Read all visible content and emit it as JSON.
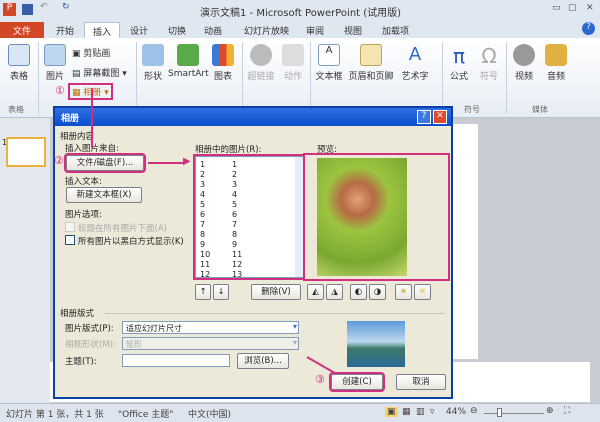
{
  "window": {
    "title": "演示文稿1 - Microsoft PowerPoint (试用版)"
  },
  "tabs": [
    "文件",
    "开始",
    "插入",
    "设计",
    "切换",
    "动画",
    "幻灯片放映",
    "审阅",
    "视图",
    "加载项"
  ],
  "ribbon": {
    "table": "表格",
    "picture": "图片",
    "clipart": "剪贴画",
    "screenshot": "屏幕截图",
    "album": "相册",
    "shapes": "形状",
    "smartart": "SmartArt",
    "chart": "图表",
    "hyperlink": "超链接",
    "action": "动作",
    "textbox": "文本框",
    "header_footer": "页眉和页脚",
    "wordart": "艺术字",
    "equation": "公式",
    "symbol": "符号",
    "video": "视频",
    "audio": "音频",
    "groups": {
      "tables": "表格",
      "symbols": "符号",
      "media": "媒体"
    }
  },
  "steps": [
    "①",
    "②",
    "③"
  ],
  "thumbnail_number": "1",
  "dialog": {
    "title": "相册",
    "album_content": "相册内容",
    "insert_from": "插入图片来自:",
    "file_disk_button": "文件/磁盘(F)...",
    "insert_text": "插入文本:",
    "new_textbox_button": "新建文本框(X)",
    "picture_options": "图片选项:",
    "caption_option": "标题在所有图片下面(A)",
    "bw_option": "所有图片以黑白方式显示(K)",
    "pictures_label": "相册中的图片(R):",
    "pictures": [
      [
        "1",
        "1"
      ],
      [
        "2",
        "2"
      ],
      [
        "3",
        "3"
      ],
      [
        "4",
        "4"
      ],
      [
        "5",
        "5"
      ],
      [
        "6",
        "6"
      ],
      [
        "7",
        "7"
      ],
      [
        "8",
        "8"
      ],
      [
        "9",
        "9"
      ],
      [
        "10",
        "11"
      ],
      [
        "11",
        "12"
      ],
      [
        "12",
        "13"
      ]
    ],
    "preview_label": "预览:",
    "remove_button": "删除(V)",
    "layout_section": "相册版式",
    "picture_layout_label": "图片版式(P):",
    "picture_layout_value": "适应幻灯片尺寸",
    "frame_shape_label": "相框形状(M):",
    "frame_shape_value": "矩形",
    "theme_label": "主题(T):",
    "theme_value": "",
    "browse_button": "浏览(B)...",
    "create_button": "创建(C)",
    "cancel_button": "取消"
  },
  "status": {
    "slide": "幻灯片 第 1 张，共 1 张",
    "theme": "\"Office 主题\"",
    "language": "中文(中国)",
    "zoom": "44%"
  }
}
